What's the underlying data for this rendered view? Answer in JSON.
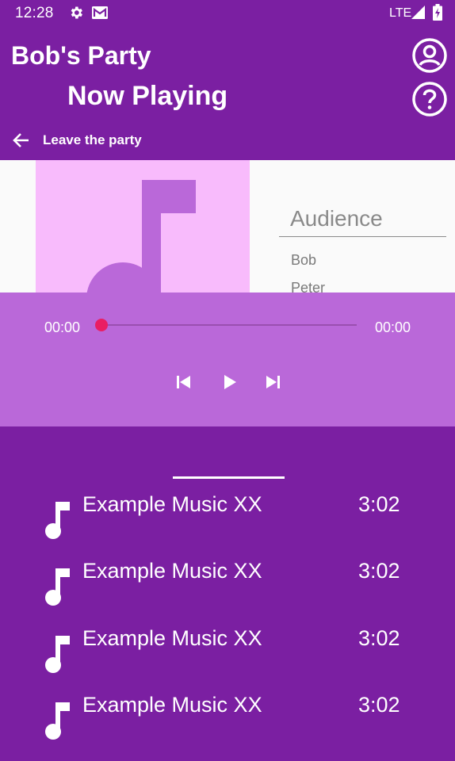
{
  "status_bar": {
    "time": "12:28",
    "network": "LTE",
    "icons": [
      "gear-icon",
      "mail-icon",
      "signal-icon",
      "battery-icon"
    ]
  },
  "header": {
    "party_name": "Bob's Party",
    "subtitle": "Now Playing",
    "leave_label": "Leave the party",
    "icons": [
      "account-circle-icon",
      "help-circle-icon",
      "arrow-back-icon"
    ]
  },
  "audience": {
    "title": "Audience",
    "members": [
      "Bob",
      "Peter"
    ]
  },
  "player": {
    "elapsed": "00:00",
    "total": "00:00",
    "progress": 0,
    "controls": [
      "skip-previous-icon",
      "play-icon",
      "skip-next-icon"
    ]
  },
  "queue": {
    "tracks": [
      {
        "title": "Example Music XX",
        "duration": "3:02"
      },
      {
        "title": "Example Music XX",
        "duration": "3:02"
      },
      {
        "title": "Example Music XX",
        "duration": "3:02"
      },
      {
        "title": "Example Music XX",
        "duration": "3:02"
      }
    ]
  },
  "colors": {
    "primary": "#7b1fa2",
    "player_bg": "#ba68d9",
    "album_art_bg": "#f8bbfc",
    "album_note": "#ba68d9",
    "seek_thumb": "#e91e63"
  }
}
